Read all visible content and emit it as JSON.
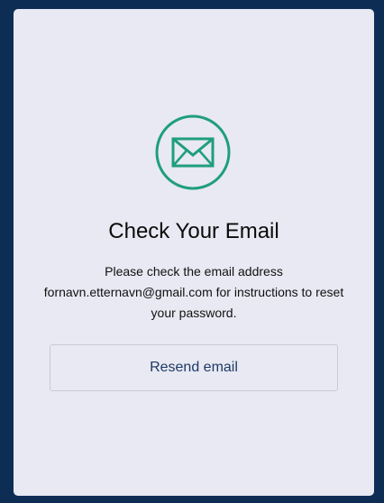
{
  "card": {
    "icon": "mail-icon",
    "title": "Check Your Email",
    "message": "Please check the email address fornavn.etternavn@gmail.com for instructions to reset your password.",
    "resend_label": "Resend email"
  },
  "colors": {
    "page_background": "#0d2d55",
    "card_background": "#e8e9f2",
    "accent": "#1f9e7f",
    "button_text": "#1e3a66"
  }
}
